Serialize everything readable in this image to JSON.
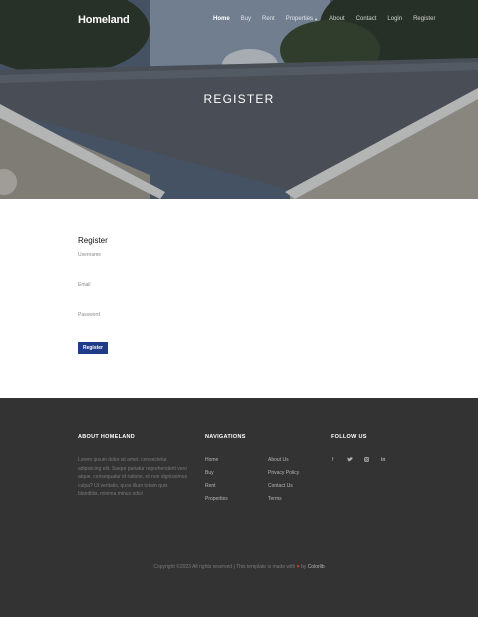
{
  "brand": {
    "logo": "Homeland"
  },
  "nav": {
    "items": [
      {
        "label": "Home",
        "active": true
      },
      {
        "label": "Buy"
      },
      {
        "label": "Rent"
      },
      {
        "label": "Properties",
        "dropdown": true
      },
      {
        "label": "About"
      },
      {
        "label": "Contact"
      },
      {
        "label": "Login"
      },
      {
        "label": "Register"
      }
    ]
  },
  "hero": {
    "title": "REGISTER"
  },
  "form": {
    "title": "Register",
    "username_label": "Username",
    "email_label": "Email",
    "password_label": "Password",
    "button": "Register"
  },
  "footer": {
    "about": {
      "heading": "ABOUT HOMELAND",
      "text": "Lorem ipsum dolor sit amet, consectetur adipisicing elit. Saepe pariatur reprehenderit vero atque, consequatur id ratione, et non dignissimos culpa? Ut veritatis, quos illum totam quis blanditiis, minima minus odio!"
    },
    "navigations": {
      "heading": "NAVIGATIONS",
      "col1": [
        "Home",
        "Buy",
        "Rent",
        "Properties"
      ],
      "col2": [
        "About Us",
        "Privacy Policy",
        "Contact Us",
        "Terms"
      ]
    },
    "follow": {
      "heading": "FOLLOW US",
      "icons": [
        "f",
        "t",
        "ig",
        "in"
      ]
    },
    "copyright": {
      "prefix": "Copyright ©2023 All rights reserved | This template is made with",
      "heart": "♥",
      "by": "by",
      "credit": "Colorlib"
    }
  },
  "colors": {
    "accent": "#1f3c88",
    "footer_bg": "#333333",
    "heart": "#e53935"
  }
}
